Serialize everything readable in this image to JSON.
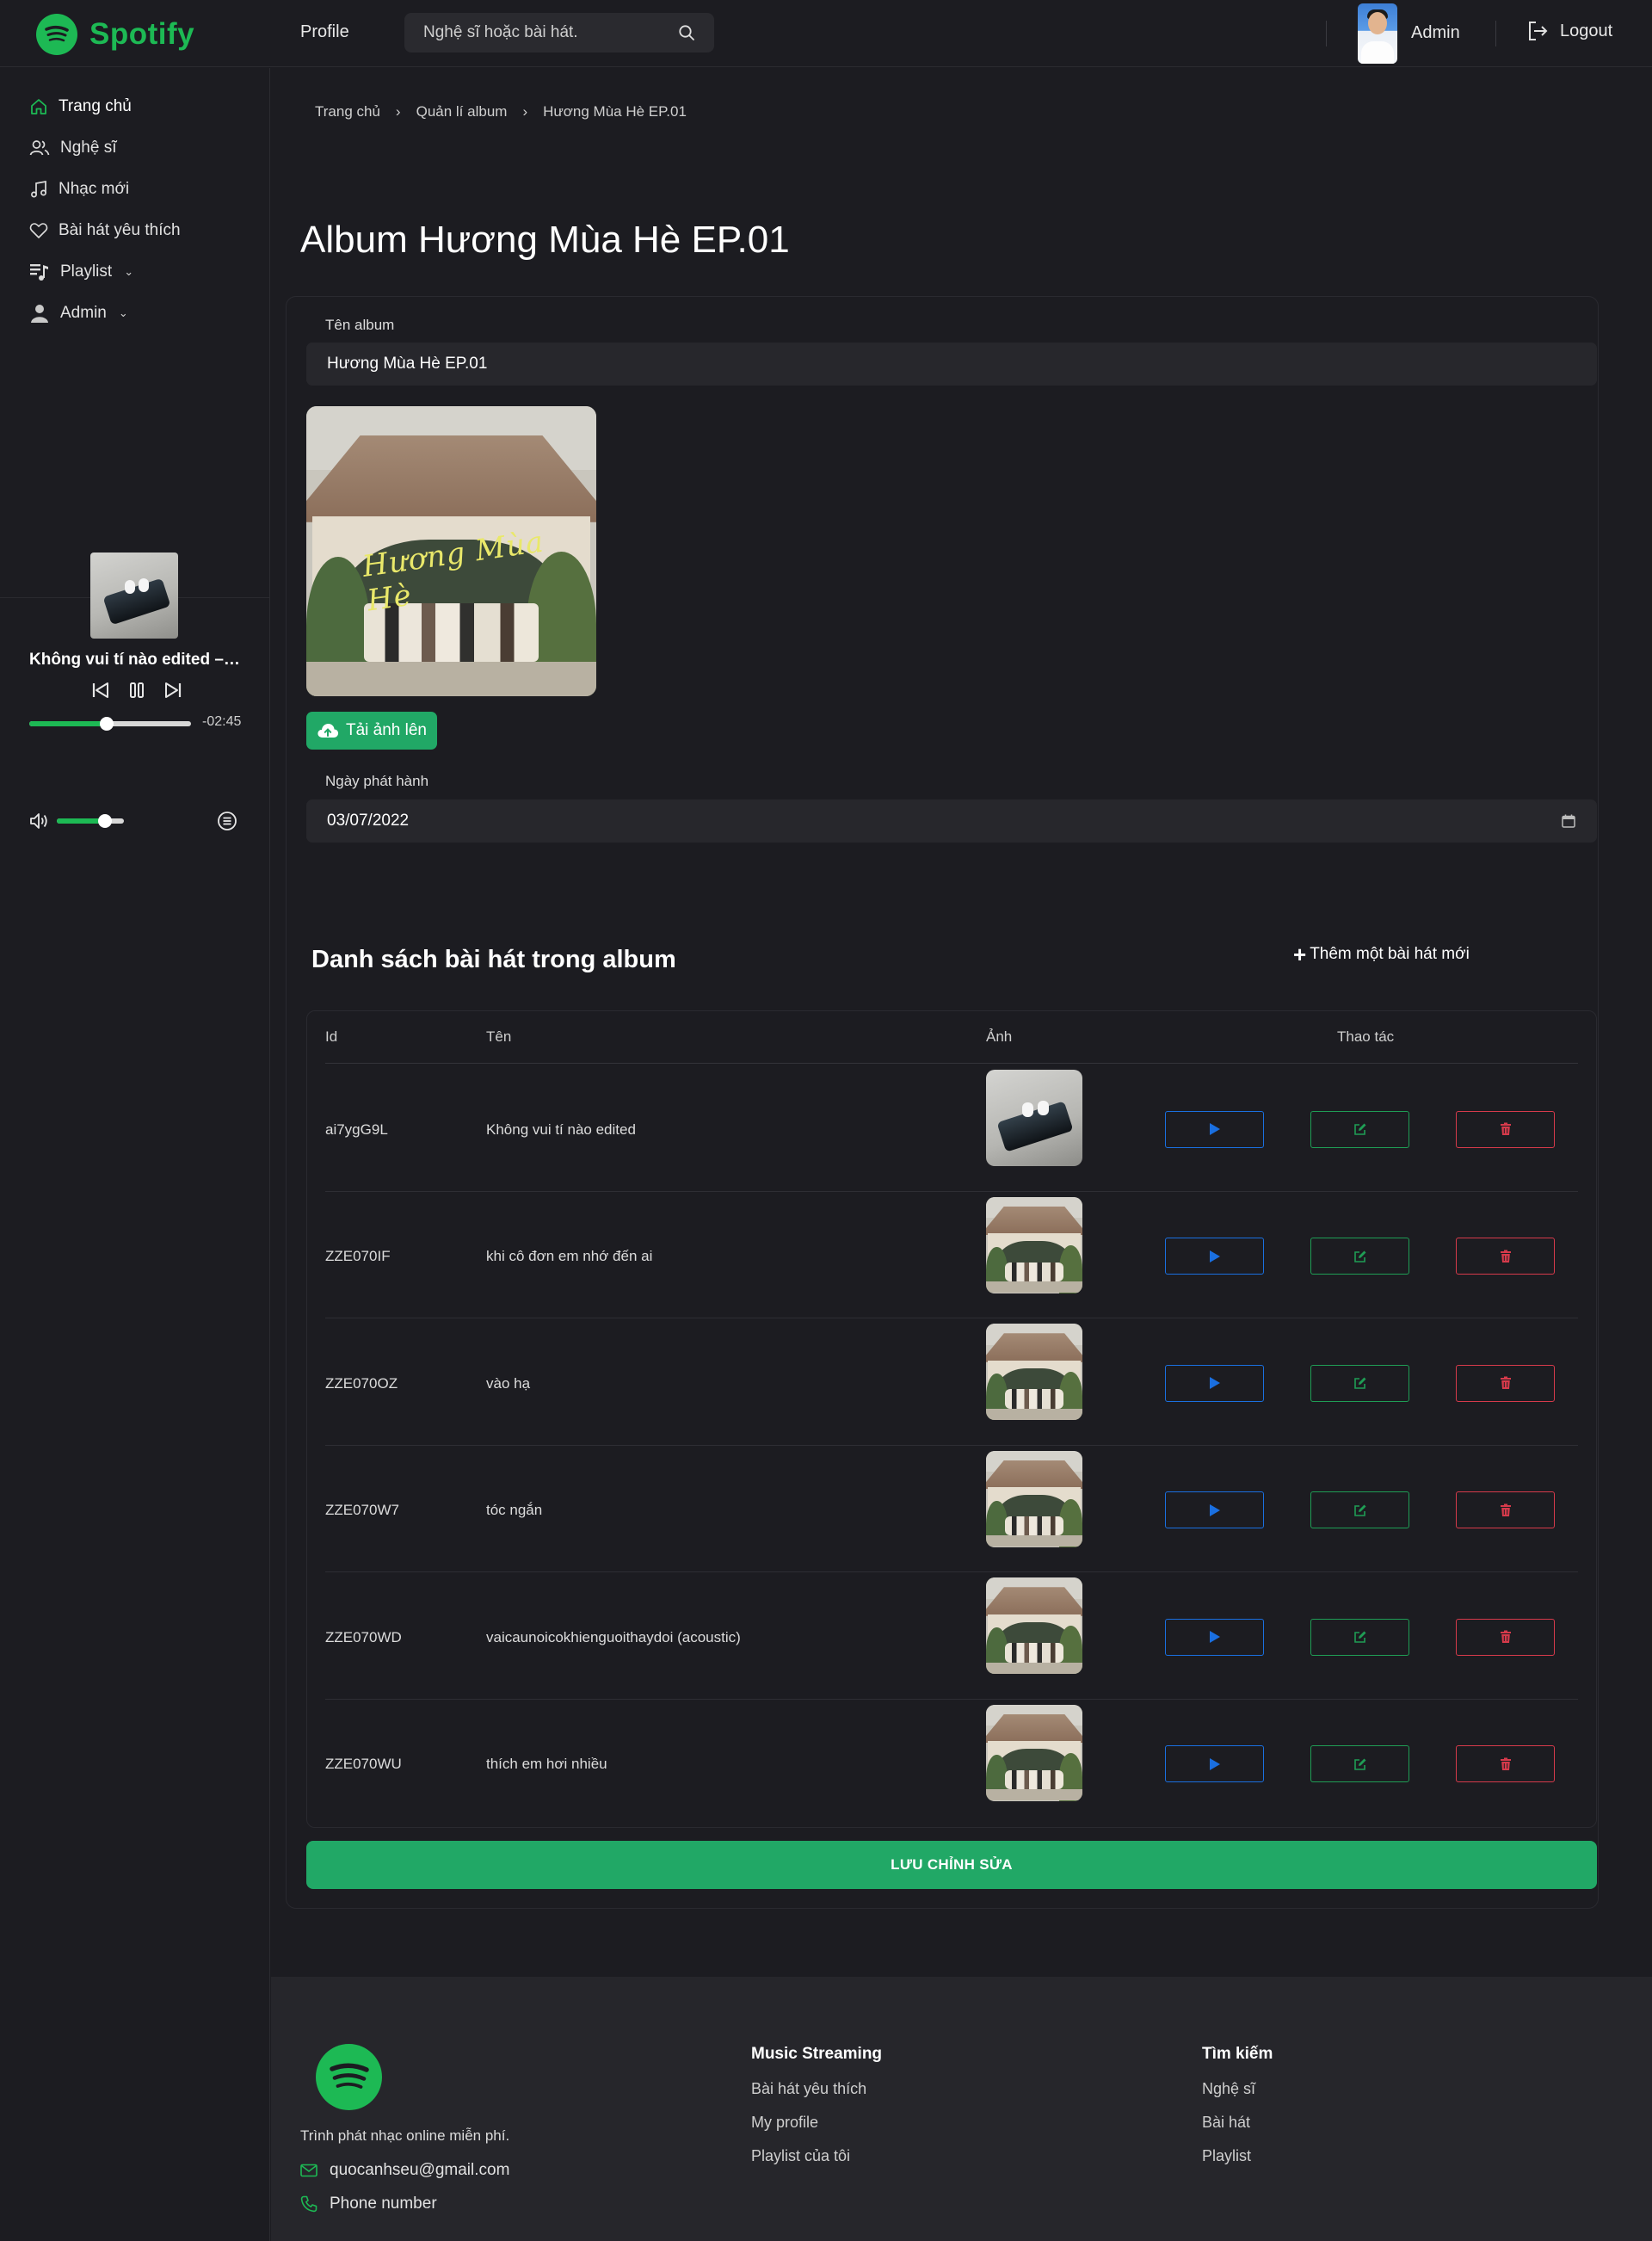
{
  "brand": {
    "name": "Spotify",
    "color": "#1db954"
  },
  "topbar": {
    "profile_link": "Profile",
    "search_placeholder": "Nghệ sĩ hoặc bài hát.",
    "admin_label": "Admin",
    "logout_label": "Logout"
  },
  "sidebar": {
    "items": [
      {
        "label": "Trang chủ",
        "icon": "home-icon",
        "active": true
      },
      {
        "label": "Nghệ sĩ",
        "icon": "users-icon"
      },
      {
        "label": "Nhạc mới",
        "icon": "music-note-icon"
      },
      {
        "label": "Bài hát yêu thích",
        "icon": "heart-icon"
      },
      {
        "label": "Playlist",
        "icon": "playlist-icon",
        "dropdown": true
      },
      {
        "label": "Admin",
        "icon": "user-icon",
        "dropdown": true
      }
    ]
  },
  "player": {
    "title": "Không vui tí nào edited – ...",
    "time_remaining": "-02:45",
    "progress": 0.48,
    "volume": 0.72
  },
  "breadcrumb": [
    "Trang chủ",
    "Quản lí album",
    "Hương Mùa Hè EP.01"
  ],
  "page": {
    "title": "Album Hương Mùa Hè EP.01"
  },
  "form": {
    "album_name_label": "Tên album",
    "album_name_value": "Hương Mùa Hè EP.01",
    "cover_text": "Hương Mùa Hè",
    "upload_label": "Tải ảnh lên",
    "release_date_label": "Ngày phát hành",
    "release_date_value": "03/07/2022"
  },
  "songs_section": {
    "title": "Danh sách bài hát trong album",
    "add_label": "Thêm một bài hát mới",
    "columns": {
      "id": "Id",
      "name": "Tên",
      "image": "Ảnh",
      "actions": "Thao tác"
    },
    "rows": [
      {
        "id": "ai7ygG9L",
        "name": "Không vui tí nào edited",
        "thumb": "earbuds"
      },
      {
        "id": "ZZE070IF",
        "name": "khi cô đơn em nhớ đến ai",
        "thumb": "album"
      },
      {
        "id": "ZZE070OZ",
        "name": "vào hạ",
        "thumb": "album"
      },
      {
        "id": "ZZE070W7",
        "name": "tóc ngắn",
        "thumb": "album"
      },
      {
        "id": "ZZE070WD",
        "name": "vaicaunoicokhienguoithaydoi (acoustic)",
        "thumb": "album"
      },
      {
        "id": "ZZE070WU",
        "name": "thích em hơi nhiều",
        "thumb": "album"
      }
    ]
  },
  "save_label": "LƯU CHỈNH SỬA",
  "footer": {
    "tagline": "Trình phát nhạc online miễn phí.",
    "email": "quocanhseu@gmail.com",
    "phone": "Phone number",
    "music_title": "Music Streaming",
    "music_links": [
      "Bài hát yêu thích",
      "My profile",
      "Playlist của tôi"
    ],
    "search_title": "Tìm kiếm",
    "search_links": [
      "Nghệ sĩ",
      "Bài hát",
      "Playlist"
    ]
  },
  "colors": {
    "accent": "#21a866",
    "play": "#1a6fe0",
    "edit": "#1f9d55",
    "delete": "#d63a4b"
  }
}
